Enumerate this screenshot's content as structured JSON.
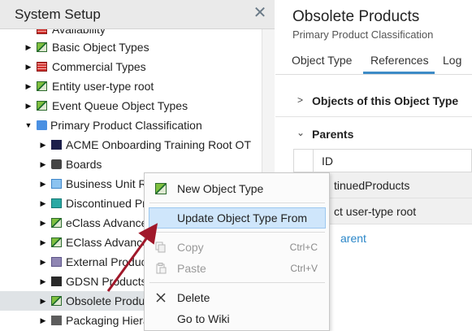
{
  "left_panel": {
    "title": "System Setup",
    "close_glyph": "✕"
  },
  "tree": {
    "items": [
      {
        "label": "Availability",
        "icon": "red-list-icon",
        "level": 1,
        "expanded": false
      },
      {
        "label": "Basic Object Types",
        "icon": "pencil-icon",
        "level": 1,
        "expanded": false
      },
      {
        "label": "Commercial Types",
        "icon": "red-list-icon",
        "level": 1,
        "expanded": false
      },
      {
        "label": "Entity user-type root",
        "icon": "pencil-icon",
        "level": 1,
        "expanded": false
      },
      {
        "label": "Event Queue Object Types",
        "icon": "pencil-icon",
        "level": 1,
        "expanded": false
      },
      {
        "label": "Primary Product Classification",
        "icon": "folder-icon",
        "level": 1,
        "expanded": true
      },
      {
        "label": "ACME Onboarding Training Root OT",
        "icon": "folder-icon",
        "level": 2,
        "expanded": false
      },
      {
        "label": "Boards",
        "icon": "board-icon",
        "level": 2,
        "expanded": false
      },
      {
        "label": "Business Unit Ro",
        "icon": "folder-icon",
        "level": 2,
        "expanded": false
      },
      {
        "label": "Discontinued Pr",
        "icon": "folder-icon",
        "level": 2,
        "expanded": false
      },
      {
        "label": "eClass Advance",
        "icon": "pencil-icon",
        "level": 2,
        "expanded": false
      },
      {
        "label": "EClass Advance",
        "icon": "pencil-icon",
        "level": 2,
        "expanded": false
      },
      {
        "label": "External Produc",
        "icon": "folder-icon",
        "level": 2,
        "expanded": false
      },
      {
        "label": "GDSN Products",
        "icon": "folder-icon",
        "level": 2,
        "expanded": false
      },
      {
        "label": "Obsolete Produ",
        "icon": "pencil-icon",
        "level": 2,
        "expanded": false,
        "selected": true
      },
      {
        "label": "Packaging Hiera",
        "icon": "folder-icon",
        "level": 2,
        "expanded": false
      }
    ]
  },
  "right_panel": {
    "title": "Obsolete Products",
    "subtitle": "Primary Product Classification",
    "tabs": [
      {
        "label": "Object Type",
        "active": false
      },
      {
        "label": "References",
        "active": true
      },
      {
        "label": "Log",
        "active": false
      }
    ],
    "section_objects": "Objects of this Object Type",
    "section_parents": "Parents",
    "grid_header_id": "ID",
    "grid_rows": [
      "tinuedProducts",
      "ct user-type root"
    ],
    "link_text": "arent"
  },
  "context_menu": {
    "items": [
      {
        "label": "New Object Type",
        "shortcut": "",
        "icon": "pencil-icon",
        "disabled": false,
        "highlighted": false
      },
      {
        "label": "Update Object Type From",
        "shortcut": "",
        "icon": "",
        "disabled": false,
        "highlighted": true
      },
      {
        "label": "Copy",
        "shortcut": "Ctrl+C",
        "icon": "copy-icon",
        "disabled": true,
        "highlighted": false
      },
      {
        "label": "Paste",
        "shortcut": "Ctrl+V",
        "icon": "paste-icon",
        "disabled": true,
        "highlighted": false
      },
      {
        "label": "Delete",
        "shortcut": "",
        "icon": "delete-icon",
        "disabled": false,
        "highlighted": false
      },
      {
        "label": "Go to Wiki",
        "shortcut": "",
        "icon": "",
        "disabled": false,
        "highlighted": false
      }
    ]
  },
  "colors": {
    "accent": "#3d8bc7",
    "highlight": "#cfe6fb",
    "annotation_arrow": "#a0182a",
    "link": "#2a86c8"
  }
}
